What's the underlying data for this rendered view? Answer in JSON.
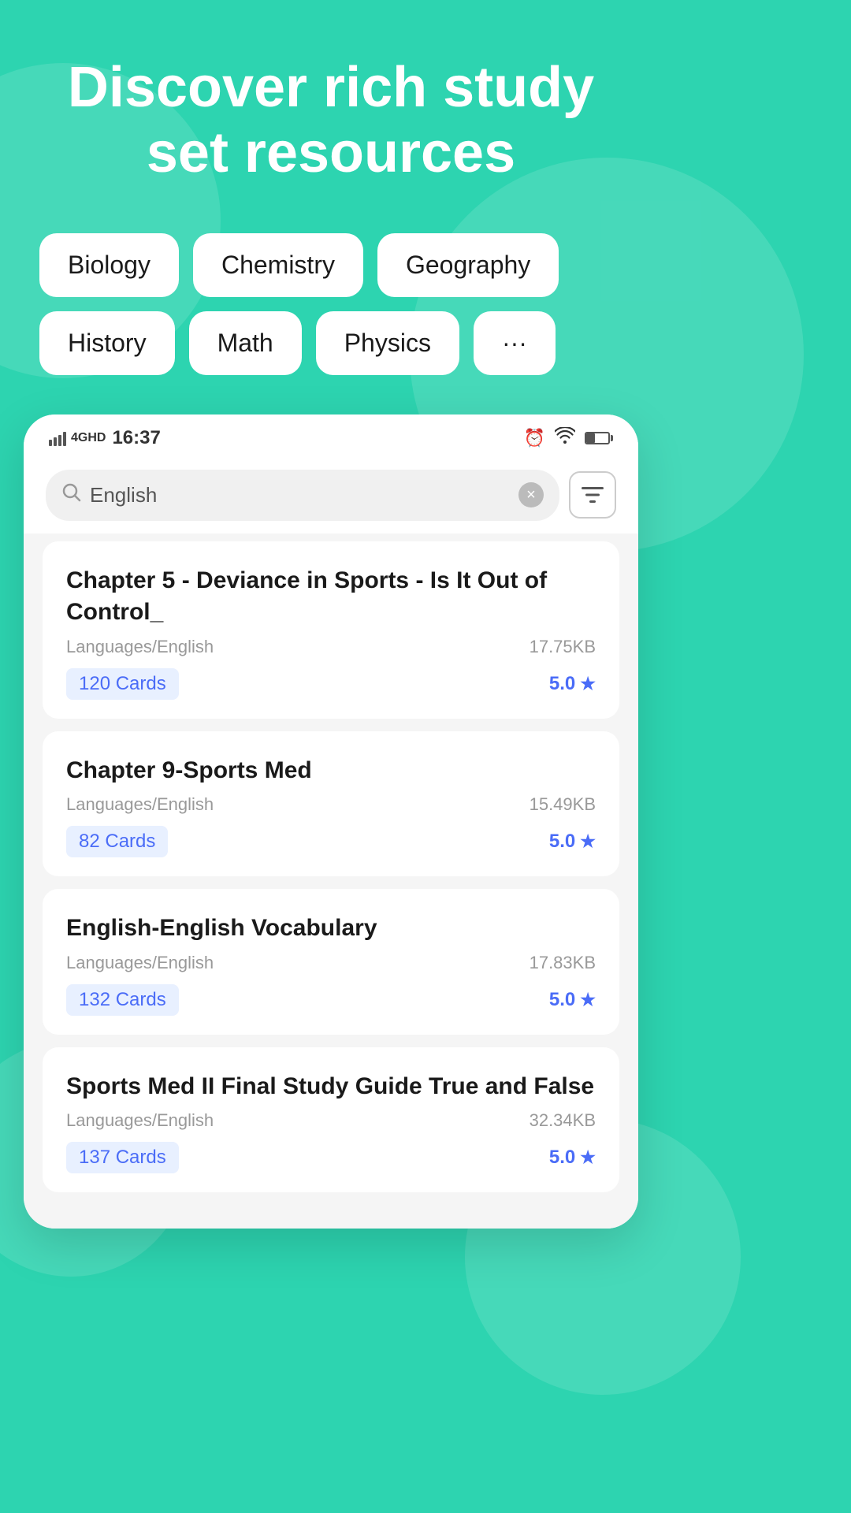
{
  "header": {
    "title": "Discover rich study set resources"
  },
  "categories": {
    "row1": [
      {
        "label": "Biology"
      },
      {
        "label": "Chemistry"
      },
      {
        "label": "Geography"
      }
    ],
    "row2": [
      {
        "label": "History"
      },
      {
        "label": "Math"
      },
      {
        "label": "Physics"
      },
      {
        "label": "···"
      }
    ]
  },
  "status_bar": {
    "signal_label": "4GHD",
    "time": "16:37",
    "wifi": "wifi",
    "battery": "battery"
  },
  "search": {
    "placeholder": "English",
    "value": "English",
    "clear_icon": "×",
    "filter_icon": "▤"
  },
  "results": [
    {
      "title": "Chapter 5 - Deviance in Sports - Is It Out of Control_",
      "category": "Languages/English",
      "size": "17.75KB",
      "cards": "120 Cards",
      "rating": "5.0"
    },
    {
      "title": "Chapter 9-Sports Med",
      "category": "Languages/English",
      "size": "15.49KB",
      "cards": "82 Cards",
      "rating": "5.0"
    },
    {
      "title": "English-English Vocabulary",
      "category": "Languages/English",
      "size": "17.83KB",
      "cards": "132 Cards",
      "rating": "5.0"
    },
    {
      "title": "Sports Med II Final Study Guide True and False",
      "category": "Languages/English",
      "size": "32.34KB",
      "cards": "137 Cards",
      "rating": "5.0"
    }
  ]
}
